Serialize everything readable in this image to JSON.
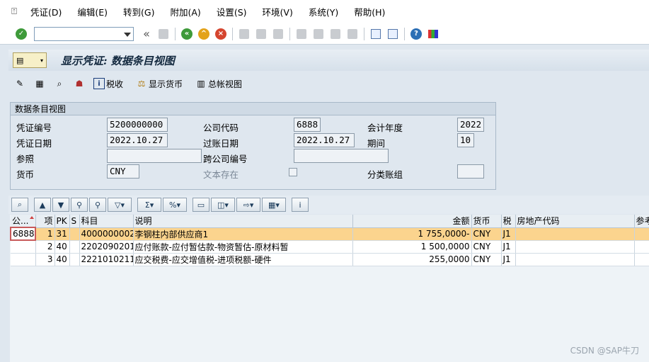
{
  "menu": {
    "items": [
      "凭证(D)",
      "编辑(E)",
      "转到(G)",
      "附加(A)",
      "设置(S)",
      "环境(V)",
      "系统(Y)",
      "帮助(H)"
    ]
  },
  "toolbar": {
    "command_value": "",
    "nav_glyph": "«"
  },
  "title": {
    "text": "显示凭证: 数据条目视图"
  },
  "app_toolbar": {
    "tax_label": "税收",
    "currency_label": "显示货币",
    "ledger_label": "总帐视图"
  },
  "header": {
    "group_title": "数据条目视图",
    "doc_no_label": "凭证编号",
    "doc_no": "5200000000",
    "company_label": "公司代码",
    "company": "6888",
    "fiscal_year_label": "会计年度",
    "fiscal_year": "2022",
    "doc_date_label": "凭证日期",
    "doc_date": "2022.10.27",
    "posting_date_label": "过账日期",
    "posting_date": "2022.10.27",
    "period_label": "期间",
    "period": "10",
    "reference_label": "参照",
    "reference": "",
    "intercompany_label": "跨公司编号",
    "intercompany": "",
    "currency_label": "货币",
    "currency": "CNY",
    "text_exists_label": "文本存在",
    "ledger_group_label": "分类账组",
    "ledger_group": ""
  },
  "grid": {
    "columns": [
      "公...",
      "项",
      "PK",
      "S",
      "科目",
      "说明",
      "金额",
      "货币",
      "税",
      "房地产代码",
      "参考"
    ],
    "rows": [
      {
        "company": "6888",
        "item": "1",
        "pk": "31",
        "s": "",
        "account": "4000000002",
        "desc": "李钢柱内部供应商1",
        "amount": "1 755,0000-",
        "currency": "CNY",
        "tax": "J1",
        "realestate": "",
        "ref": ""
      },
      {
        "company": "",
        "item": "2",
        "pk": "40",
        "s": "",
        "account": "2202090201",
        "desc": "应付账款-应付暂估款-物资暂估-原材料暂",
        "amount": "1 500,0000",
        "currency": "CNY",
        "tax": "J1",
        "realestate": "",
        "ref": ""
      },
      {
        "company": "",
        "item": "3",
        "pk": "40",
        "s": "",
        "account": "2221010211",
        "desc": "应交税费-应交增值税-进项税额-硬件",
        "amount": "255,0000",
        "currency": "CNY",
        "tax": "J1",
        "realestate": "",
        "ref": ""
      }
    ]
  },
  "watermark": "CSDN @SAP牛刀",
  "colors": {
    "selected_row": "#fbd48e",
    "background": "#dfe7ef"
  }
}
